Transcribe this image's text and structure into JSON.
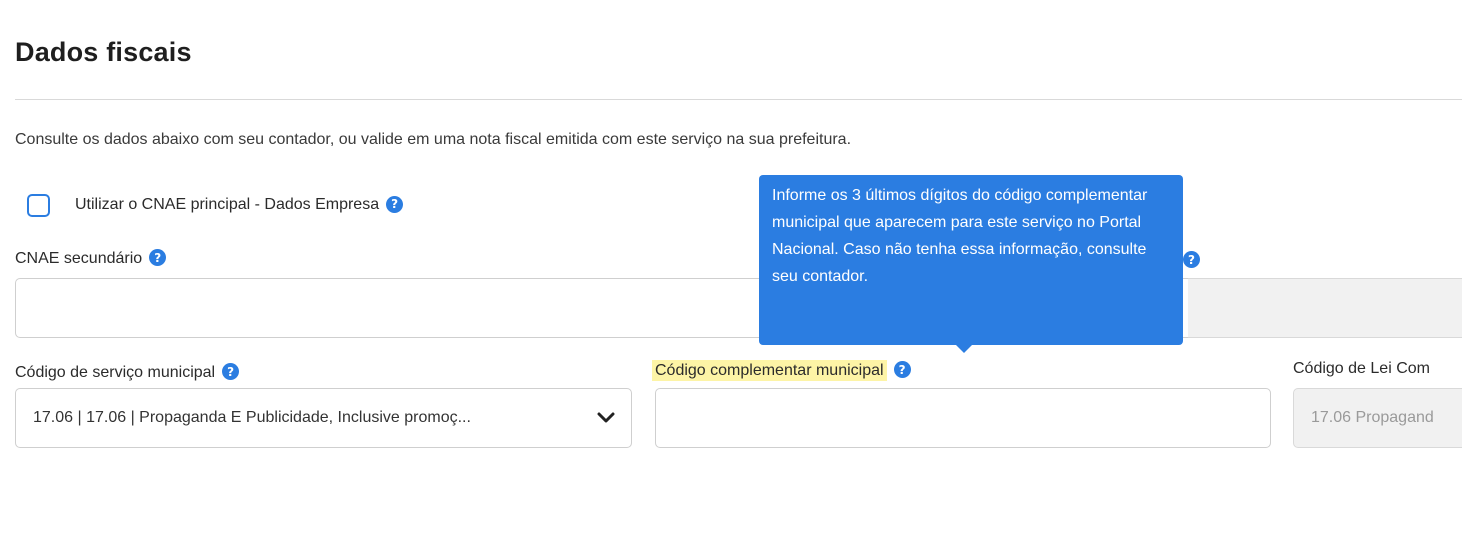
{
  "page": {
    "title": "Dados fiscais",
    "intro": "Consulte os dados abaixo com seu contador, ou valide em uma nota fiscal emitida com este serviço na sua prefeitura."
  },
  "cnae_principal_checkbox": {
    "label": "Utilizar o CNAE principal - Dados Empresa",
    "checked": false
  },
  "cnae_secundario": {
    "label": "CNAE secundário",
    "value": ""
  },
  "codigo_servico_municipal": {
    "label": "Código de serviço municipal",
    "selected": "17.06 | 17.06 | Propaganda E Publicidade, Inclusive promoç..."
  },
  "codigo_complementar_municipal": {
    "label": "Código complementar municipal",
    "value": ""
  },
  "codigo_lei_complementar": {
    "label": "Código de Lei Com",
    "value": "17.06 Propagand"
  },
  "tooltip": {
    "text": "Informe os 3 últimos dígitos do código complementar municipal que aparecem para este serviço no Portal Nacional. Caso não tenha essa informação, consulte seu contador."
  },
  "icons": {
    "help": "question-circle-icon",
    "dropdown": "chevron-down-icon"
  },
  "colors": {
    "accent": "#2b7de1",
    "highlight": "#fdf4a6",
    "disabled_bg": "#f1f1f1"
  }
}
